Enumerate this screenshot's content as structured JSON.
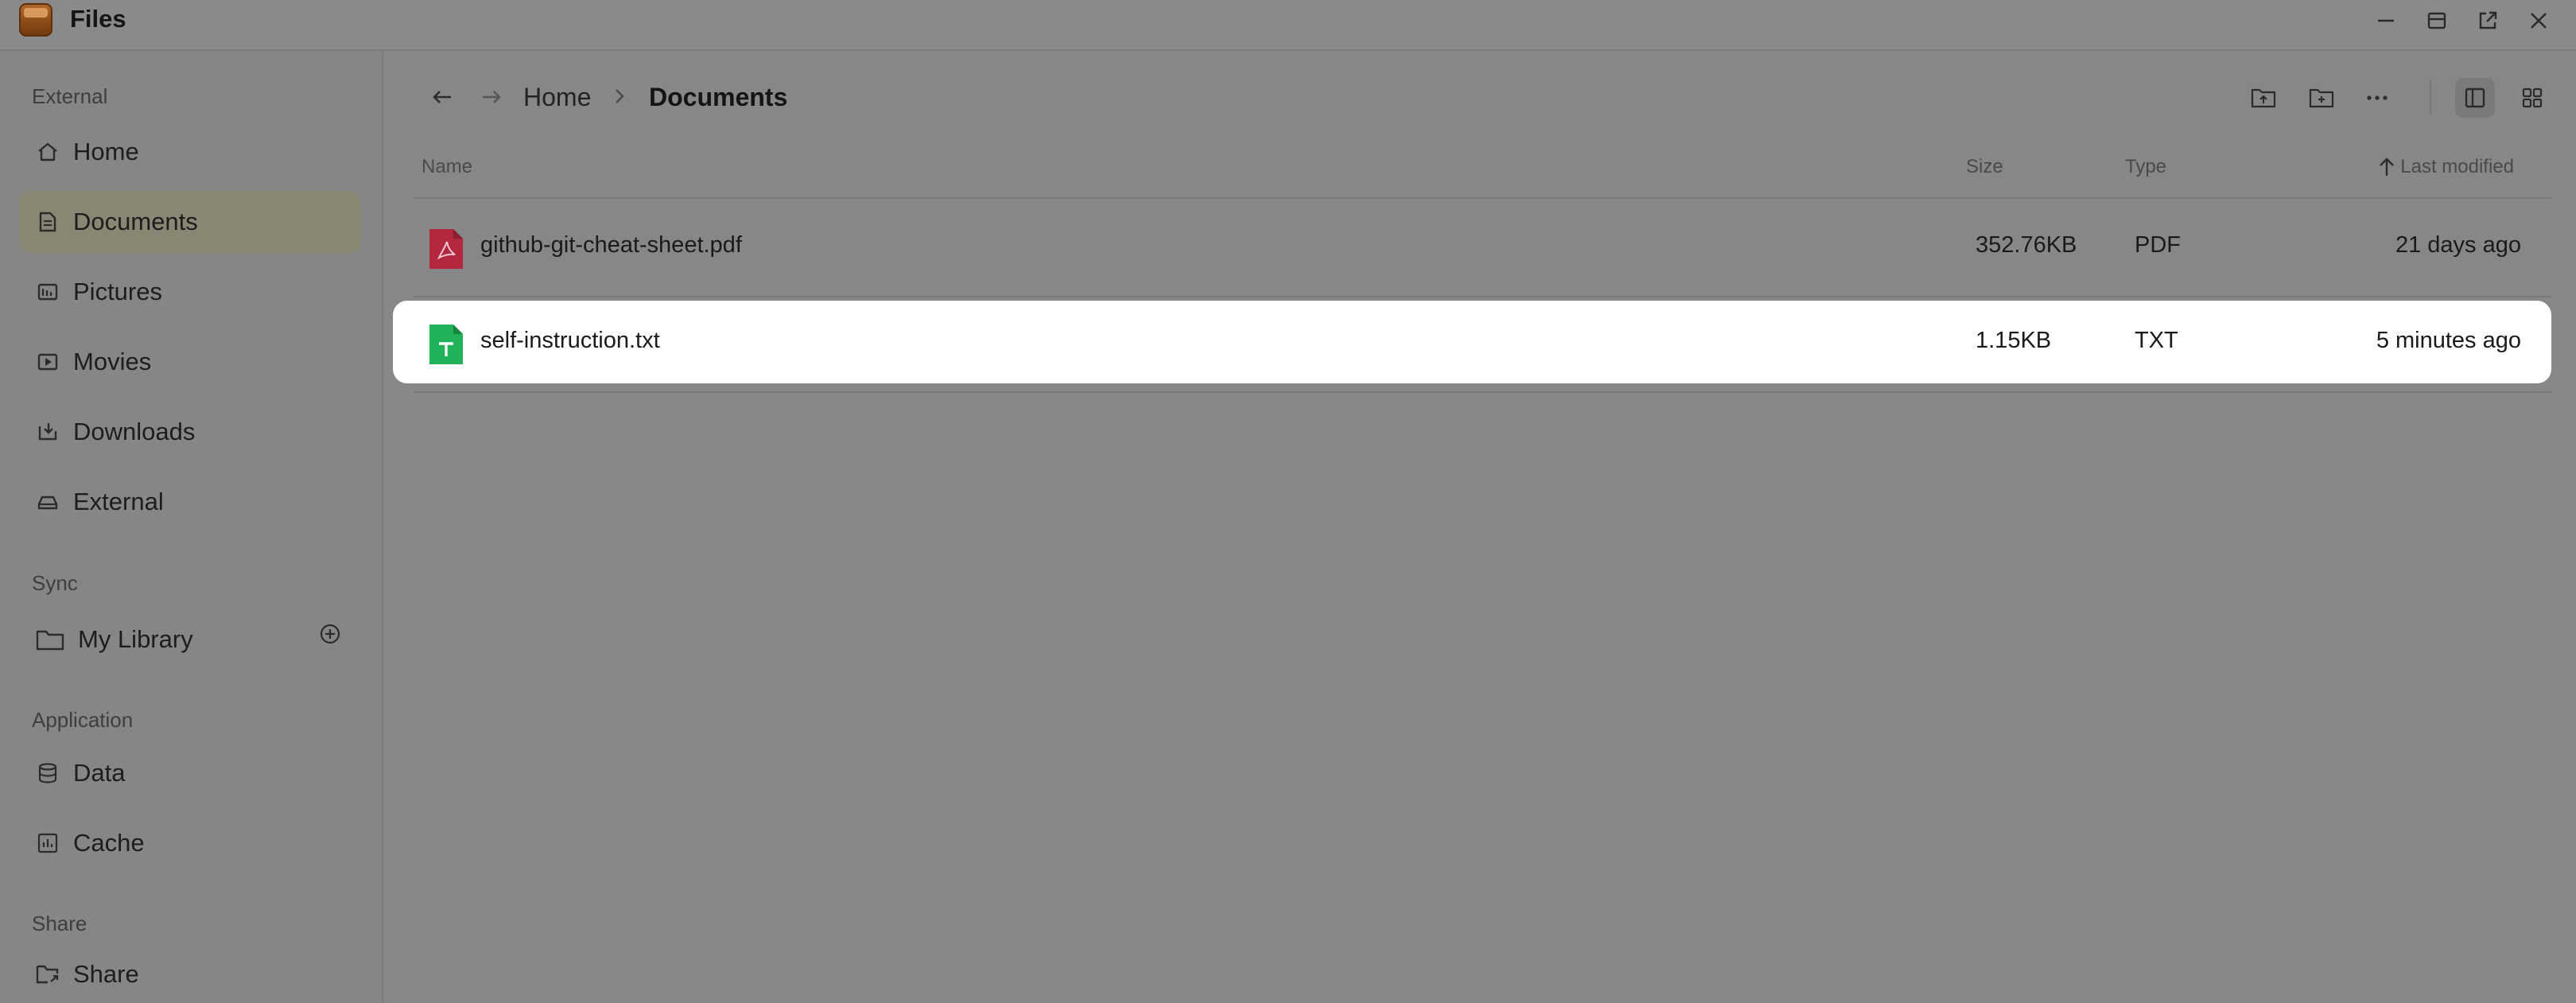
{
  "window": {
    "app_title": "Files",
    "controls": [
      "minimize-icon",
      "maximize-icon",
      "pop-out-icon",
      "close-icon"
    ]
  },
  "sidebar": {
    "sections": [
      {
        "title": "External",
        "items": [
          {
            "label": "Home",
            "icon": "home-icon",
            "active": false
          },
          {
            "label": "Documents",
            "icon": "document-icon",
            "active": true
          },
          {
            "label": "Pictures",
            "icon": "pictures-icon",
            "active": false
          },
          {
            "label": "Movies",
            "icon": "movie-icon",
            "active": false
          },
          {
            "label": "Downloads",
            "icon": "download-icon",
            "active": false
          },
          {
            "label": "External",
            "icon": "drive-icon",
            "active": false
          }
        ]
      },
      {
        "title": "Sync",
        "items": [
          {
            "label": "My Library",
            "icon": "folder-icon",
            "active": false
          }
        ]
      },
      {
        "title": "Application",
        "items": [
          {
            "label": "Data",
            "icon": "database-icon",
            "active": false
          },
          {
            "label": "Cache",
            "icon": "chart-icon",
            "active": false
          }
        ]
      },
      {
        "title": "Share",
        "items": [
          {
            "label": "Share",
            "icon": "share-folder-icon",
            "active": false
          }
        ]
      }
    ]
  },
  "breadcrumb": {
    "home": "Home",
    "current": "Documents"
  },
  "toolbar": {
    "buttons": [
      "upload-icon",
      "new-folder-icon",
      "more-icon",
      "list-view-icon",
      "grid-view-icon"
    ],
    "active_view": "list-view"
  },
  "table": {
    "columns": {
      "name": "Name",
      "size": "Size",
      "type": "Type",
      "modified": "Last modified"
    },
    "sort": {
      "column": "Last modified",
      "direction": "ascending"
    },
    "rows": [
      {
        "name": "github-git-cheat-sheet.pdf",
        "size": "352.76KB",
        "type": "PDF",
        "modified": "21 days ago",
        "icon": "pdf-file-icon",
        "selected": false
      },
      {
        "name": "self-instruction.txt",
        "size": "1.15KB",
        "type": "TXT",
        "modified": "5 minutes ago",
        "icon": "txt-file-icon",
        "selected": true
      }
    ]
  },
  "colors": {
    "dim_overlay": "#858585",
    "selected_row": "#ffffff",
    "active_sidebar": "#898773",
    "pdf_icon": "#b3283f",
    "txt_icon": "#21b35a"
  }
}
